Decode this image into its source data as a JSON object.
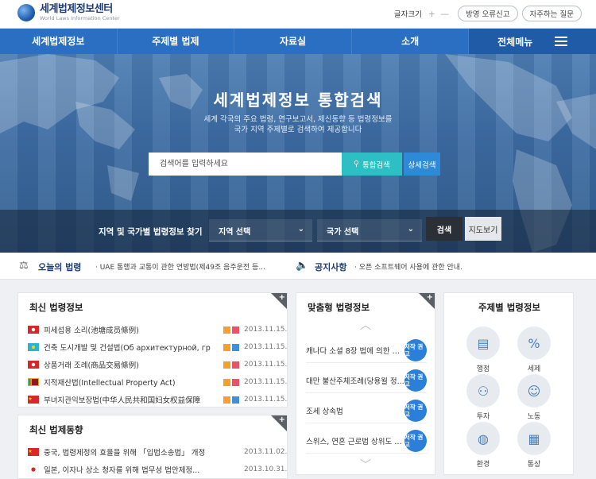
{
  "header": {
    "logo_kr": "세계법제정보센터",
    "logo_en": "World Laws Information Center",
    "font_size_label": "글자크기",
    "zoom_in": "+",
    "zoom_out": "—",
    "login": "방영 오류신고",
    "faq": "자주하는 질문"
  },
  "nav": {
    "items": [
      "세계법제정보",
      "주제별 법제",
      "자료실",
      "소개"
    ],
    "all_menu": "전체메뉴"
  },
  "hero": {
    "title": "세계법제정보 통합검색",
    "subtitle_1": "세계 각국의 주요 법령, 연구보고서, 제신동향 등 법령정보를",
    "subtitle_2": "국가 지역 주제별로 검색하여 제공합니다",
    "search_placeholder": "검색어를 입력하세요",
    "search_button": "통합검색",
    "detail_button": "상세검색",
    "filter_label": "지역 및 국가별 법령정보 찾기",
    "region_select": "지역 선택",
    "country_select": "국가 선택",
    "go_button": "검색",
    "map_button": "지도보기"
  },
  "ticker": {
    "today_title": "오늘의 법령",
    "today_text": "· UAE 통행과 교통이 관한 연방법(제49조 음주운전 등...",
    "notice_title": "공지사항",
    "notice_text": "· 오픈 소프트웨어 사용에 관한 안내."
  },
  "latest_laws": {
    "title": "최신 법령정보",
    "plus": "+",
    "rows": [
      {
        "title": "피세섭용 소리(池塘成员條例)",
        "date": "2013.11.15."
      },
      {
        "title": "건축 도시개발 및 건설법(Об архитектурной, гр",
        "date": "2013.11.15."
      },
      {
        "title": "상품거래 조례(商品交易條例)",
        "date": "2013.11.15."
      },
      {
        "title": "지적재산법(Intellectual Property Act)",
        "date": "2013.11.15."
      },
      {
        "title": "부녀지관익보장법(中华人民共和国妇女权益保障",
        "date": "2013.11.15."
      }
    ]
  },
  "latest_trends": {
    "title": "최신 법제동향",
    "plus": "+",
    "rows": [
      {
        "title": "중국, 법령제정의 효율을 위해 「입법소송법」 개정",
        "date": "2013.11.02."
      },
      {
        "title": "일본, 이자나 상소 청자를 위해 법무성 법안제정...",
        "date": "2013.10.31."
      }
    ]
  },
  "custom_laws": {
    "title": "맞춤형 법령정보",
    "plus": "+",
    "rows": [
      {
        "title": "캐나다 소셜 8장 법에 의한 요신청...",
        "badge": "저작 권고"
      },
      {
        "title": "대만 불산주체조례(당용월 정...",
        "badge": "저작 권고"
      },
      {
        "title": "조세 상속법",
        "badge": "저작 권고"
      },
      {
        "title": "스위스, 연혼 근로법 상위도 바...",
        "badge": "저작 권고"
      }
    ]
  },
  "topics": {
    "title": "주제별 법령정보",
    "items": [
      {
        "label": "행정",
        "icon": "document-icon"
      },
      {
        "label": "세제",
        "icon": "tax-icon"
      },
      {
        "label": "투자",
        "icon": "investment-icon"
      },
      {
        "label": "노동",
        "icon": "worker-icon"
      },
      {
        "label": "환경",
        "icon": "globe-icon"
      },
      {
        "label": "통상",
        "icon": "trade-icon"
      }
    ]
  },
  "colors": {
    "nav_blue": "#2a6fc2",
    "search_teal": "#2dbfc3",
    "detail_blue": "#2e8ad6",
    "badge_blue": "#2b7fd8"
  }
}
